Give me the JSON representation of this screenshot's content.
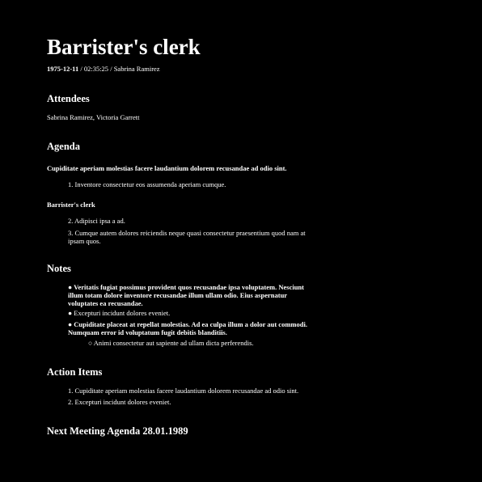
{
  "document": {
    "title": "Barrister's clerk",
    "meta": {
      "date": "1975-12-11",
      "sep1": " / ",
      "time": "02:35:25",
      "sep2": " / ",
      "author": "Sabrina Ramirez"
    },
    "attendees": {
      "heading": "Attendees",
      "names": "Sabrina Ramirez, Victoria Garrett"
    },
    "agenda": {
      "heading": "Agenda",
      "intro": "Cupiditate aperiam molestias facere laudantium dolorem recusandae ad odio sint.",
      "list1": [
        {
          "num": "1.",
          "text": "Inventore consectetur eos assumenda aperiam cumque."
        }
      ],
      "subheading": "Barrister's clerk",
      "list2": [
        {
          "num": "2.",
          "text": "Adipisci ipsa a ad."
        },
        {
          "num": "3.",
          "text": "Cumque autem dolores reiciendis neque quasi consectetur praesentium quod nam at ipsam quos."
        }
      ]
    },
    "notes": {
      "heading": "Notes",
      "bullet": "●",
      "sub_bullet": "○",
      "items": [
        {
          "text": "Veritatis fugiat possimus provident quos recusandae ipsa voluptatem. Nesciunt illum totam dolore inventore recusandae illum ullam odio. Eius aspernatur voluptates ea recusandae."
        },
        {
          "text": "Excepturi incidunt dolores eveniet."
        },
        {
          "text": "Cupiditate placeat at repellat molestias. Ad ea culpa illum a dolor aut commodi. Numquam error id voluptatum fugit debitis blanditiis."
        }
      ],
      "sub_items": [
        {
          "text": "Animi consectetur aut sapiente ad ullam dicta perferendis."
        }
      ]
    },
    "action_items": {
      "heading": "Action Items",
      "items": [
        {
          "num": "1.",
          "text": "Cupiditate aperiam molestias facere laudantium dolorem recusandae ad odio sint."
        },
        {
          "num": "2.",
          "text": "Excepturi incidunt dolores eveniet."
        }
      ]
    },
    "next_meeting": {
      "heading": "Next Meeting Agenda 28.01.1989"
    }
  }
}
